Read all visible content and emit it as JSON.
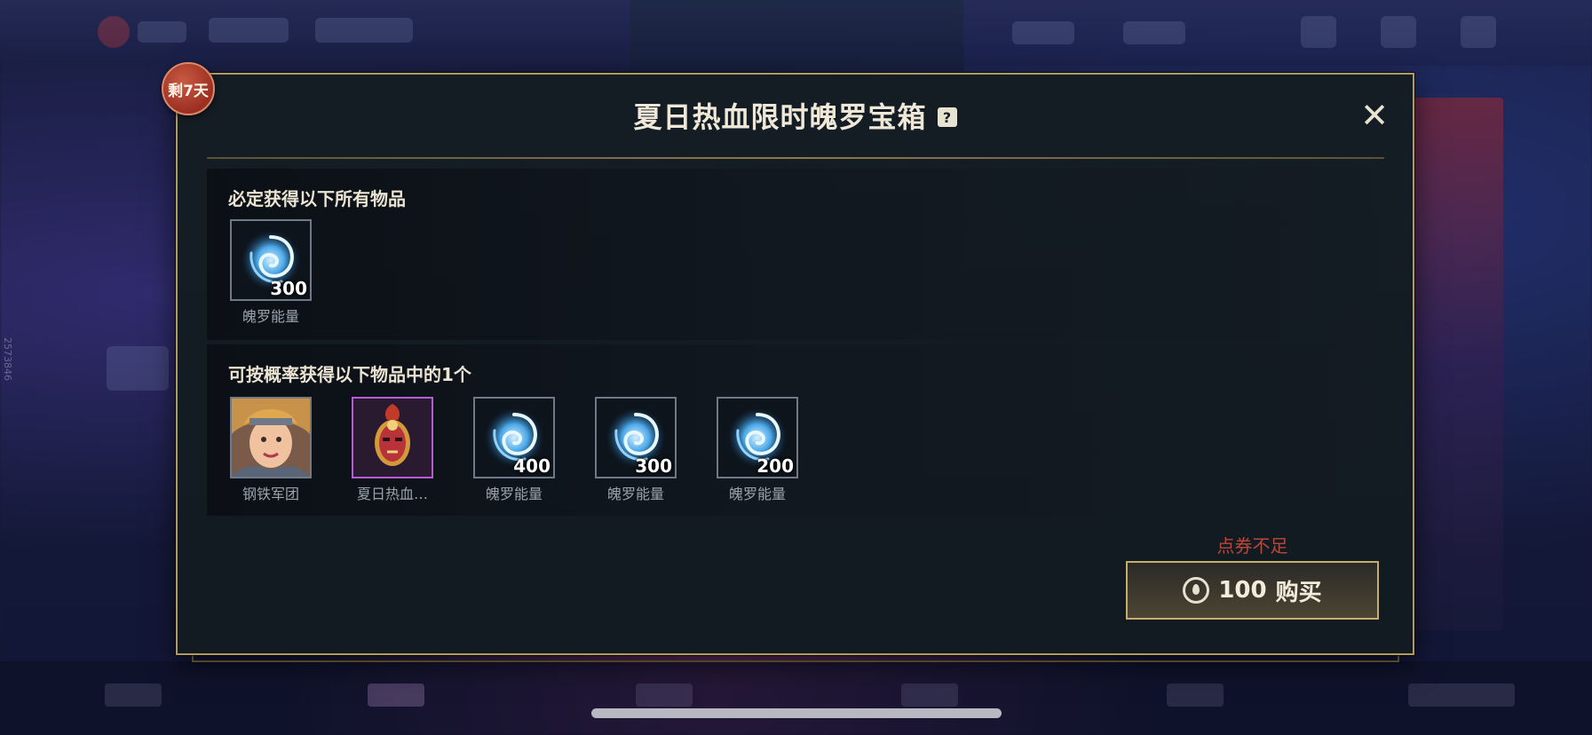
{
  "dialog": {
    "badge": "剩7天",
    "title": "夏日热血限时魄罗宝箱",
    "help_glyph": "?",
    "close_glyph": "✕"
  },
  "guaranteed": {
    "label": "必定获得以下所有物品",
    "items": [
      {
        "name": "魄罗能量",
        "count": "300",
        "icon": "poro-energy-swirl-icon"
      }
    ]
  },
  "random": {
    "label": "可按概率获得以下物品中的1个",
    "items": [
      {
        "name": "钢铁军团",
        "count": "",
        "icon": "champion-portrait"
      },
      {
        "name": "夏日热血…",
        "count": "",
        "icon": "mask-emote-icon"
      },
      {
        "name": "魄罗能量",
        "count": "400",
        "icon": "poro-energy-swirl-icon"
      },
      {
        "name": "魄罗能量",
        "count": "300",
        "icon": "poro-energy-swirl-icon"
      },
      {
        "name": "魄罗能量",
        "count": "200",
        "icon": "poro-energy-swirl-icon"
      }
    ]
  },
  "purchase": {
    "warning": "点券不足",
    "price": "100",
    "label": "购买"
  },
  "background": {
    "side_id": "2573846"
  }
}
